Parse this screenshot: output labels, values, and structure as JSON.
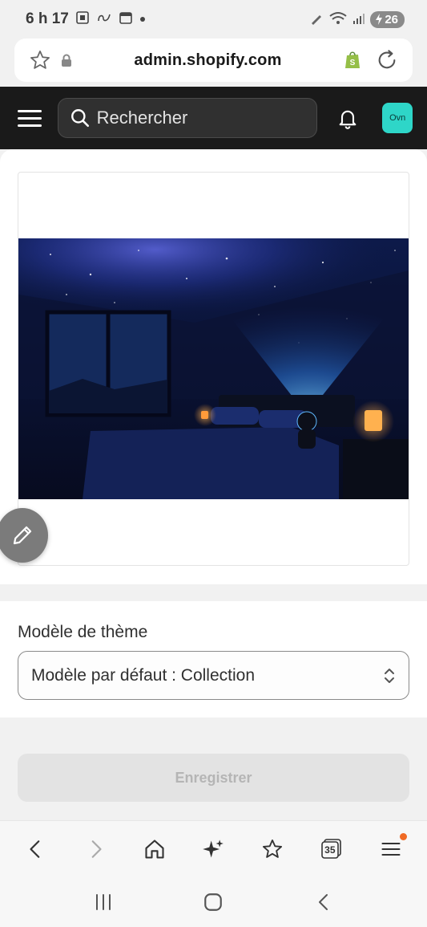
{
  "status_bar": {
    "time": "6 h 17",
    "battery": "26"
  },
  "browser": {
    "url": "admin.shopify.com"
  },
  "header": {
    "search_placeholder": "Rechercher",
    "avatar_initials": "Ovn",
    "avatar_color": "#2ed6c8"
  },
  "media": {
    "image_description_icon": "galaxy-projector-bedroom-image"
  },
  "theme_template": {
    "label": "Modèle de thème",
    "selected": "Modèle par défaut : Collection"
  },
  "actions": {
    "save_label": "Enregistrer"
  },
  "browser_toolbar": {
    "tabs_count": "35"
  },
  "colors": {
    "header_bg": "#1a1a1a",
    "badge_orange": "#f06a24",
    "shopify_green": "#95bf47"
  }
}
